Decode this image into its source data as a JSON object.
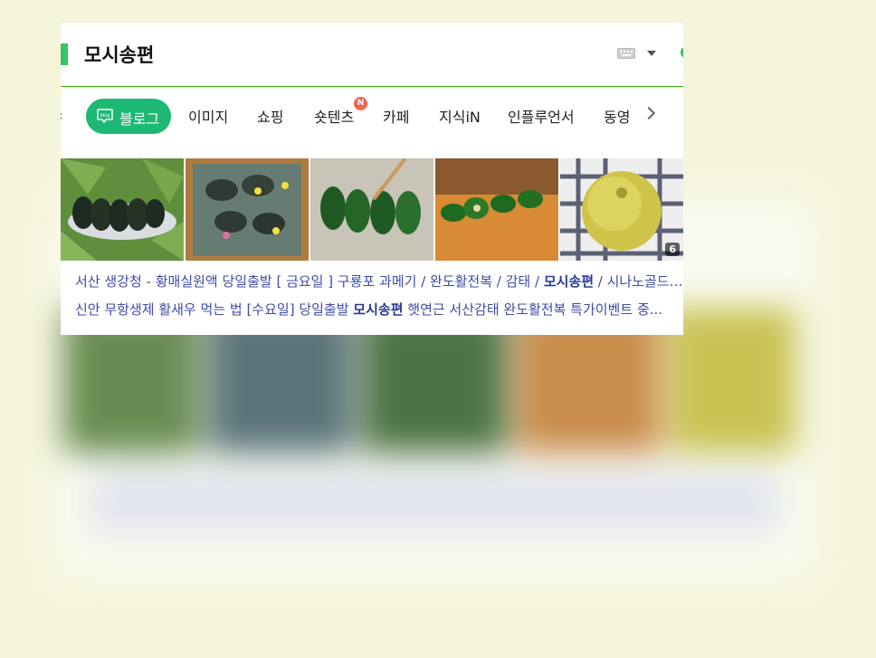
{
  "search": {
    "query": "모시송편"
  },
  "tabs": {
    "items": [
      {
        "label": "블로그",
        "active": true
      },
      {
        "label": "이미지"
      },
      {
        "label": "쇼핑"
      },
      {
        "label": "숏텐츠",
        "badge": "N"
      },
      {
        "label": "카페"
      },
      {
        "label": "지식iN"
      },
      {
        "label": "인플루언서"
      },
      {
        "label": "동영"
      }
    ]
  },
  "results": {
    "image_more_count": "6",
    "line1": {
      "before": "서산 생강청 - 황매실원액 당일출발 [ 금요일 ] 구룡포 과메기 / 완도활전복 / 감태 / ",
      "bold": "모시송편",
      "after": " / 시나노골드 사과 ..."
    },
    "line2": {
      "before": "신안 무항생제 활새우 먹는 법 [수요일] 당일출발 ",
      "bold": "모시송편",
      "after": " 햇연근 서산감태 완도활전복 특가이벤트 중..."
    }
  },
  "colors": {
    "accent_green": "#1db873",
    "link_blue": "#3e4ca7",
    "badge_red": "#f2644b",
    "background": "#f5f5dc"
  }
}
